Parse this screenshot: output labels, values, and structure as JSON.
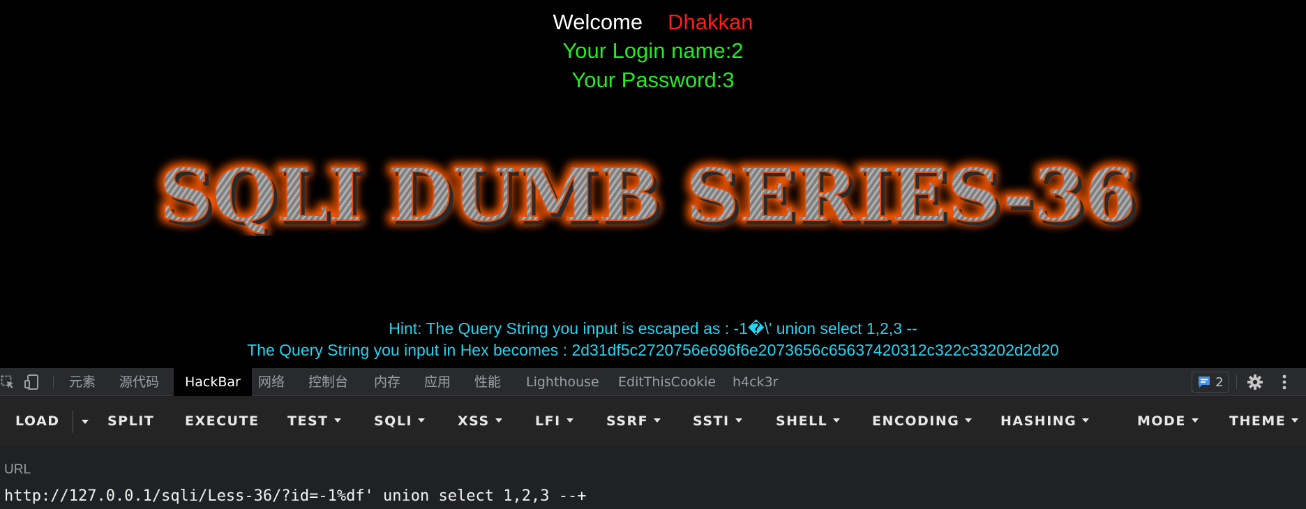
{
  "page": {
    "welcome": "Welcome",
    "username": "Dhakkan",
    "login_line": "Your Login name:2",
    "password_line": "Your Password:3",
    "banner_title": "SQLI DUMB SERIES-36",
    "hint_line": "Hint: The Query String you input is escaped as : -1�\\' union select 1,2,3 --",
    "hex_line": "The Query String you input in Hex becomes : 2d31df5c2720756e696f6e2073656c65637420312c322c33202d2d20"
  },
  "devtools": {
    "tabs": [
      {
        "label": "元素"
      },
      {
        "label": "源代码"
      },
      {
        "label": "HackBar",
        "active": true
      },
      {
        "label": "网络"
      },
      {
        "label": "控制台"
      },
      {
        "label": "内存"
      },
      {
        "label": "应用"
      },
      {
        "label": "性能"
      },
      {
        "label": "Lighthouse"
      },
      {
        "label": "EditThisCookie"
      },
      {
        "label": "h4ck3r"
      }
    ],
    "issues_count": "2"
  },
  "hackbar": {
    "load": "LOAD",
    "split": "SPLIT",
    "execute": "EXECUTE",
    "test": "TEST",
    "sqli": "SQLI",
    "xss": "XSS",
    "lfi": "LFI",
    "ssrf": "SSRF",
    "ssti": "SSTI",
    "shell": "SHELL",
    "encoding": "ENCODING",
    "hashing": "HASHING",
    "mode": "MODE",
    "theme": "THEME",
    "url_label": "URL",
    "url_value": "http://127.0.0.1/sqli/Less-36/?id=-1%df' union select 1,2,3 --+"
  },
  "colors": {
    "background": "#000000",
    "welcome": "#ffffff",
    "username": "#ff1b1b",
    "credentials": "#22ee22",
    "hint": "#21d6f5",
    "banner_glow": "#ff5a00"
  }
}
